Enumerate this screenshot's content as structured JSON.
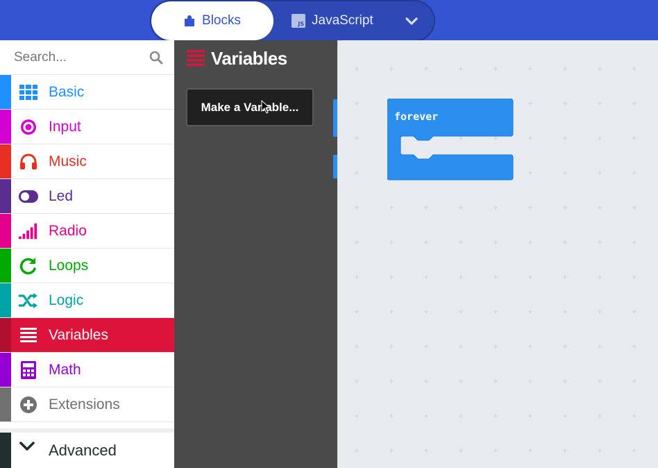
{
  "header": {
    "toggle": {
      "blocks_label": "Blocks",
      "javascript_label": "JavaScript",
      "js_badge_text": "JS"
    }
  },
  "sidebar": {
    "search_placeholder": "Search...",
    "categories": [
      {
        "label": "Basic",
        "color": "#1e90ff",
        "icon": "grid-icon"
      },
      {
        "label": "Input",
        "color": "#d400d4",
        "icon": "target-icon"
      },
      {
        "label": "Music",
        "color": "#e63022",
        "icon": "headphones-icon"
      },
      {
        "label": "Led",
        "color": "#5c2d91",
        "icon": "toggle-icon"
      },
      {
        "label": "Radio",
        "color": "#e3008c",
        "icon": "signal-bars-icon"
      },
      {
        "label": "Loops",
        "color": "#00aa00",
        "icon": "loop-arrow-icon"
      },
      {
        "label": "Logic",
        "color": "#00a4a6",
        "icon": "shuffle-icon"
      },
      {
        "label": "Variables",
        "color": "#dc143c",
        "icon": "list-lines-icon",
        "selected": true
      },
      {
        "label": "Math",
        "color": "#9400d3",
        "icon": "calculator-icon"
      },
      {
        "label": "Extensions",
        "color": "#717171",
        "icon": "plus-circle-icon"
      }
    ],
    "advanced": {
      "label": "Advanced",
      "color": "#1f2e2e",
      "icon": "chevron-down-icon"
    }
  },
  "flyout": {
    "title": "Variables",
    "color": "#dc143c",
    "make_variable_button": "Make a Variable..."
  },
  "workspace": {
    "blocks": [
      {
        "label": "forever",
        "color": "#1e90ff"
      }
    ]
  }
}
